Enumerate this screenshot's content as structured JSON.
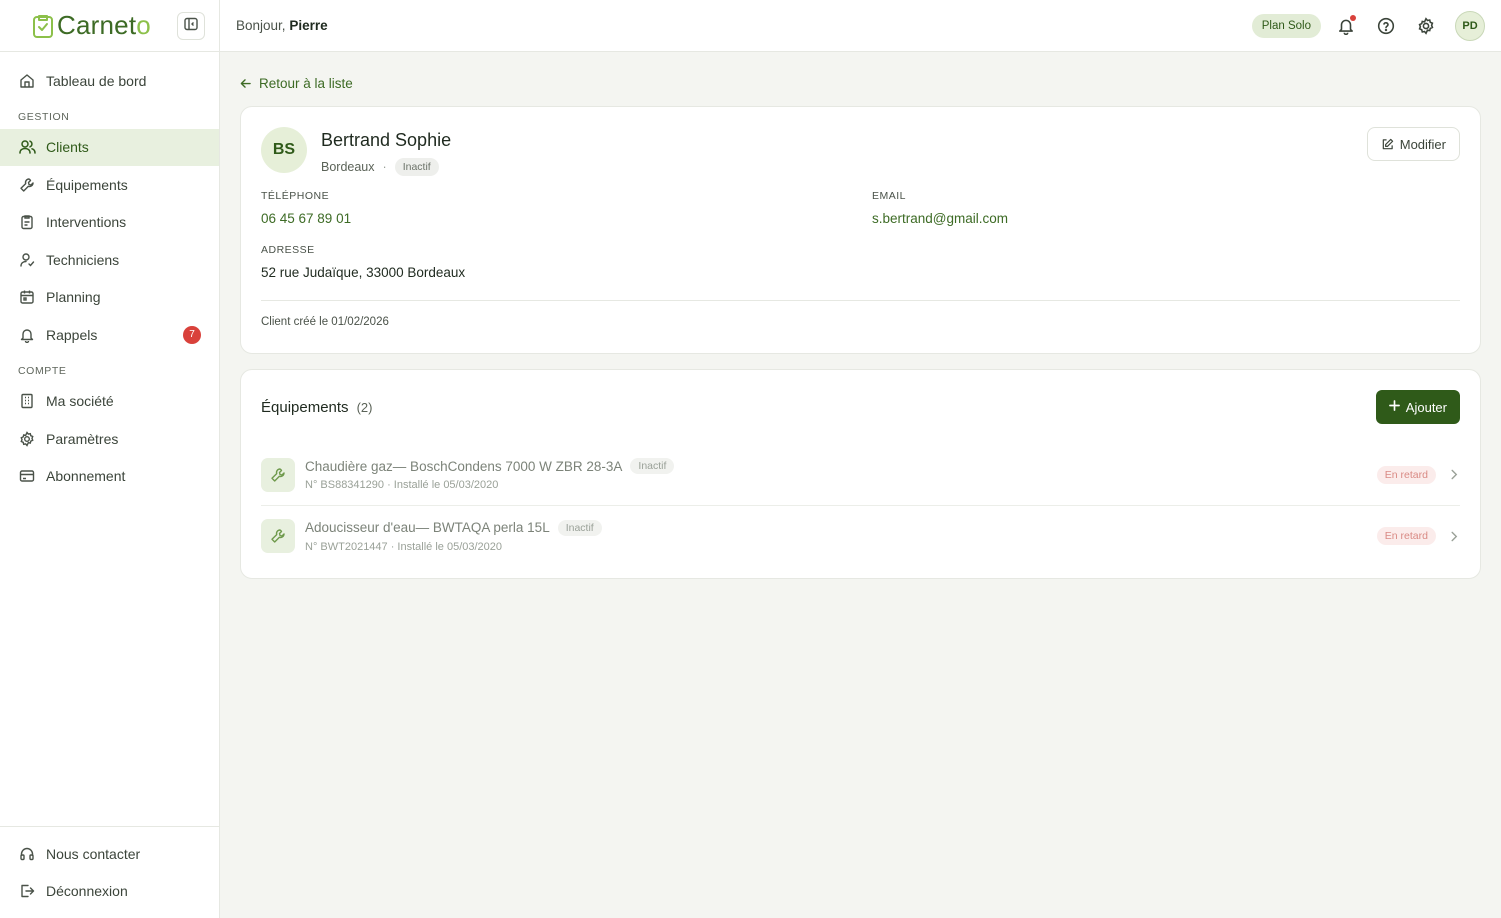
{
  "brand": {
    "name_prefix": "Carnet",
    "name_suffix": "o",
    "accent": "#3d6b25",
    "accent_light": "#8cc04a"
  },
  "sidebar": {
    "items_top": [
      {
        "label": "Tableau de bord",
        "icon": "home-icon"
      }
    ],
    "section_gestion": "GESTION",
    "items_gestion": [
      {
        "label": "Clients",
        "icon": "users-icon",
        "active": true
      },
      {
        "label": "Équipements",
        "icon": "wrench-icon"
      },
      {
        "label": "Interventions",
        "icon": "clipboard-icon"
      },
      {
        "label": "Techniciens",
        "icon": "user-check-icon"
      },
      {
        "label": "Planning",
        "icon": "calendar-icon"
      },
      {
        "label": "Rappels",
        "icon": "bell-icon",
        "badge": "7"
      }
    ],
    "section_compte": "COMPTE",
    "items_compte": [
      {
        "label": "Ma société",
        "icon": "building-icon"
      },
      {
        "label": "Paramètres",
        "icon": "gear-icon"
      },
      {
        "label": "Abonnement",
        "icon": "credit-card-icon"
      }
    ],
    "items_bottom": [
      {
        "label": "Nous contacter",
        "icon": "headset-icon"
      },
      {
        "label": "Déconnexion",
        "icon": "logout-icon"
      }
    ]
  },
  "topbar": {
    "greeting_prefix": "Bonjour,",
    "user_first_name": "Pierre",
    "plan": "Plan Solo",
    "avatar_initials": "PD"
  },
  "main": {
    "back_label": "Retour à la liste",
    "client": {
      "initials": "BS",
      "name": "Bertrand Sophie",
      "city": "Bordeaux",
      "status": "Inactif",
      "modify_label": "Modifier",
      "phone_label": "TÉLÉPHONE",
      "phone": "06 45 67 89 01",
      "email_label": "EMAIL",
      "email": "s.bertrand@gmail.com",
      "address_label": "ADRESSE",
      "address": "52 rue Judaïque, 33000 Bordeaux",
      "created": "Client créé le 01/02/2026"
    },
    "equipments": {
      "title": "Équipements",
      "count": "(2)",
      "add_label": "Ajouter",
      "items": [
        {
          "name": "Chaudière gaz— BoschCondens 7000 W ZBR 28-3A",
          "status": "Inactif",
          "meta": "N° BS88341290 · Installé le 05/03/2020",
          "badge": "En retard"
        },
        {
          "name": "Adoucisseur d'eau— BWTAQA perla 15L",
          "status": "Inactif",
          "meta": "N° BWT2021447 · Installé le 05/03/2020",
          "badge": "En retard"
        }
      ]
    }
  }
}
